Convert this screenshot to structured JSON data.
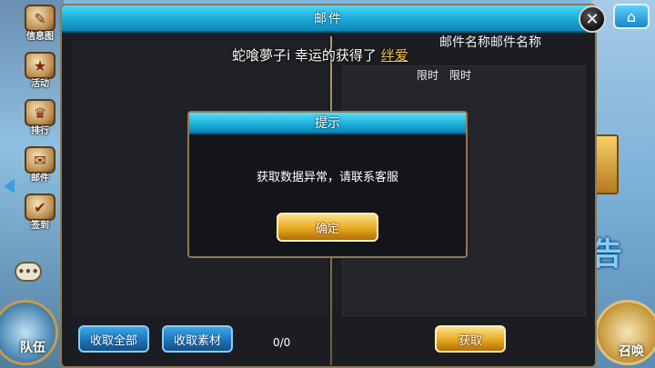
{
  "sidebar": {
    "items": [
      {
        "label": "信息图",
        "icon": "info-icon"
      },
      {
        "label": "活动",
        "icon": "activity-icon"
      },
      {
        "label": "排行",
        "icon": "ranking-icon"
      },
      {
        "label": "邮件",
        "icon": "mail-icon"
      },
      {
        "label": "签到",
        "icon": "checkin-icon"
      }
    ]
  },
  "bottom": {
    "left_label": "队伍",
    "right_label": "召唤"
  },
  "right_sign_text": "告",
  "mail_panel": {
    "title": "邮件",
    "notice": {
      "prefix": "蛇喰夢子i 幸运的获得了 ",
      "item": "绊爱"
    },
    "detail_title": "邮件名称邮件名称",
    "deadline_labels": [
      "限时",
      "限时"
    ],
    "buttons": {
      "collect_all": "收取全部",
      "collect_materials": "收取素材",
      "claim": "获取"
    },
    "count": "0/0"
  },
  "dialog": {
    "title": "提示",
    "message": "获取数据异常，请联系客服",
    "confirm": "确定"
  },
  "colors": {
    "title_bar": "#1fb2de",
    "gold_button": "#e7a91f",
    "blue_button": "#1d6fb6",
    "highlight": "#f5c34a"
  }
}
